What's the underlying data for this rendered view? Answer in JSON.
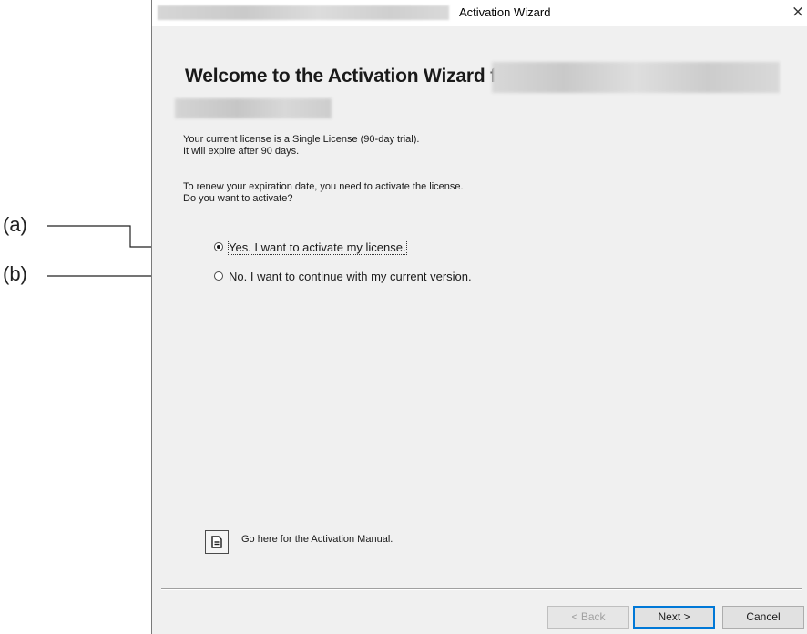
{
  "window": {
    "title": "Activation Wizard",
    "close_glyph": "×"
  },
  "content": {
    "heading": "Welcome to the Activation Wizard for",
    "license_line1": "Your current license is a Single License (90-day trial).",
    "license_line2": "It will expire after 90 days.",
    "renew_line1": "To renew your expiration date, you need to activate the license.",
    "renew_line2": "Do you want to activate?"
  },
  "options": [
    {
      "label": "Yes. I want to activate my license.",
      "checked": true
    },
    {
      "label": "No. I want to continue with my current version.",
      "checked": false
    }
  ],
  "manual": {
    "icon": "document-icon",
    "text": "Go here for the Activation Manual."
  },
  "buttons": {
    "back": "< Back",
    "next": "Next >",
    "cancel": "Cancel"
  },
  "callouts": {
    "a": "(a)",
    "b": "(b)"
  }
}
